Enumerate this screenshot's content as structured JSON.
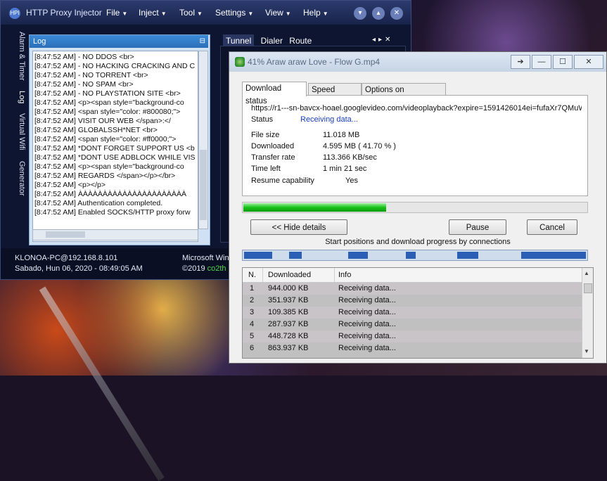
{
  "hpi": {
    "app_title": "HTTP Proxy Injector",
    "menu": [
      "File",
      "Inject",
      "Tool",
      "Settings",
      "View",
      "Help"
    ],
    "side_tabs": [
      "Alarm & Timer",
      "Log",
      "Virtual Wifi",
      "Generator"
    ],
    "right_tabs": [
      "Tunnel",
      "Dialer",
      "Route"
    ],
    "log_title": "Log",
    "log_lines": [
      "[8:47:52 AM]   - NO DDOS        <br>",
      "[8:47:52 AM]   - NO HACKING CRACKING AND C",
      "[8:47:52 AM]   - NO TORRENT   <br>",
      "[8:47:52 AM]   - NO SPAM      <br>",
      "[8:47:52 AM]   - NO PLAYSTATION SITE  <br>",
      "[8:47:52 AM] <p><span style=\"background-co",
      "[8:47:52 AM] <span style=\"color: #800080;\">",
      "[8:47:52 AM] VISIT OUR WEB        </span>:</",
      "[8:47:52 AM] GLOBALSSH*NET      <br>",
      "[8:47:52 AM] <span style=\"color: #ff0000;\">",
      "[8:47:52 AM] *DONT FORGET SUPPORT US <b",
      "[8:47:52 AM] *DONT USE ADBLOCK WHILE VIS",
      "[8:47:52 AM] <p><span style=\"background-co",
      "[8:47:52 AM] REGARDS </span></p></br>",
      "[8:47:52 AM] <p></p>",
      "[8:47:52 AM] ÀÀÀÀÀÀÀÀÀÀÀÀÀÀÀÀÀÀÀÀÀÀ",
      "[8:47:52 AM] Authentication completed.",
      "[8:47:52 AM] Enabled SOCKS/HTTP proxy forw"
    ],
    "status_host": "KLONOA-PC@192.168.8.101",
    "status_date": "Sabado, Hun 06, 2020 - 08:49:05 AM",
    "status_os": "Microsoft Win",
    "status_copy": "©2019",
    "status_brand": "co2th"
  },
  "idm": {
    "title": "41% Araw araw Love - Flow G.mp4",
    "tabs": [
      "Download status",
      "Speed Limiter",
      "Options on completion"
    ],
    "url": "https://r1---sn-bavcx-hoael.googlevideo.com/videoplayback?expire=1591426014ei=fufaXr7QMuW",
    "status_label": "Status",
    "status_value": "Receiving data...",
    "file_size_label": "File size",
    "file_size_value": "11.018  MB",
    "downloaded_label": "Downloaded",
    "downloaded_value": "4.595  MB  ( 41.70 % )",
    "transfer_label": "Transfer rate",
    "transfer_value": "113.366  KB/sec",
    "time_left_label": "Time left",
    "time_left_value": "1 min 21 sec",
    "resume_label": "Resume capability",
    "resume_value": "Yes",
    "progress_percent": 41.7,
    "hide_details": "<< Hide details",
    "pause": "Pause",
    "cancel": "Cancel",
    "connections_caption": "Start positions and download progress by connections",
    "table_headers": [
      "N.",
      "Downloaded",
      "Info"
    ],
    "rows": [
      {
        "n": "1",
        "downloaded": "944.000  KB",
        "info": "Receiving data..."
      },
      {
        "n": "2",
        "downloaded": "351.937  KB",
        "info": "Receiving data..."
      },
      {
        "n": "3",
        "downloaded": "109.385  KB",
        "info": "Receiving data..."
      },
      {
        "n": "4",
        "downloaded": "287.937  KB",
        "info": "Receiving data..."
      },
      {
        "n": "5",
        "downloaded": "448.728  KB",
        "info": "Receiving data..."
      },
      {
        "n": "6",
        "downloaded": "863.937  KB",
        "info": "Receiving data..."
      }
    ]
  }
}
